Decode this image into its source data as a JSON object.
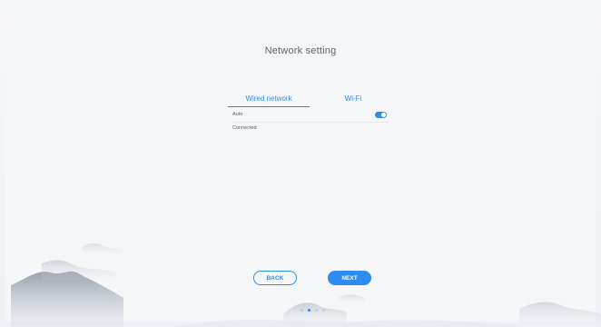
{
  "header": {
    "title": "Network setting"
  },
  "tabs": [
    {
      "label": "Wired network",
      "active": true
    },
    {
      "label": "Wi-Fi",
      "active": false
    }
  ],
  "settings": {
    "auto_label": "Auto",
    "auto_enabled": true,
    "status": "Connected"
  },
  "buttons": {
    "back_label": "BACK",
    "next_label": "NEXT"
  },
  "pager": {
    "total": 4,
    "current": 2
  },
  "colors": {
    "accent": "#2d8cf0",
    "text": "#5b6470",
    "background": "#f5f6f8"
  }
}
